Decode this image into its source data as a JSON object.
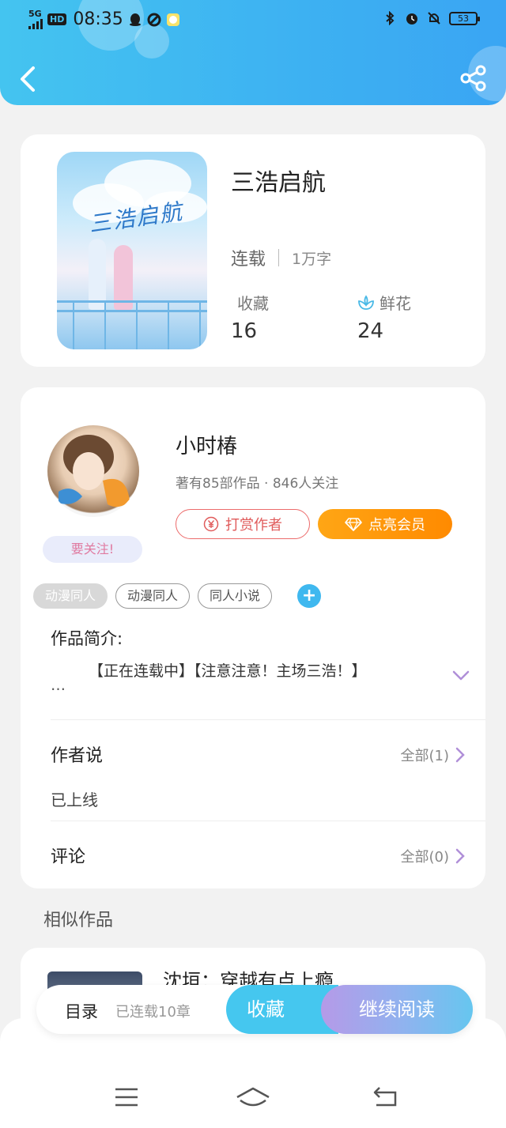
{
  "status_bar": {
    "network": "5G",
    "hd": "HD",
    "time": "08:35",
    "battery": "53"
  },
  "book": {
    "title": "三浩启航",
    "cover_title": "三浩启航",
    "status": "连载",
    "word_count": "1万字",
    "favorites_label": "收藏",
    "favorites_value": "16",
    "flowers_label": "鲜花",
    "flowers_value": "24"
  },
  "author": {
    "name": "小时椿",
    "meta": "著有85部作品 · 846人关注",
    "follow_tag": "要关注!",
    "reward_label": "打赏作者",
    "vip_label": "点亮会员"
  },
  "tags": [
    "动漫同人",
    "动漫同人",
    "同人小说"
  ],
  "intro": {
    "label": "作品简介:",
    "text": "【正在连载中】【注意注意！主场三浩！】",
    "ellipsis": "…"
  },
  "author_says": {
    "title": "作者说",
    "all": "全部(1)",
    "text": "已上线"
  },
  "comments": {
    "title": "评论",
    "all": "全部(0)"
  },
  "similar": {
    "section_title": "相似作品",
    "first_title": "沈垣：穿越有点上瘾"
  },
  "bottom_bar": {
    "toc": "目录",
    "chapters": "已连载10章",
    "collect": "收藏",
    "read": "继续阅读"
  },
  "colors": {
    "header": "#3db1f2",
    "accent": "#45c7ef",
    "vip": "#ff8a00",
    "reward": "#e05b5b"
  }
}
